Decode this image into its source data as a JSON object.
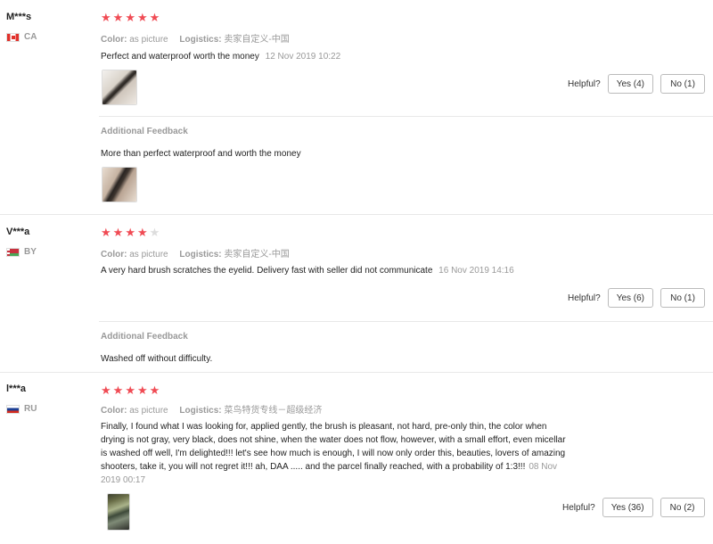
{
  "labels": {
    "color": "Color:",
    "logistics": "Logistics:",
    "helpful": "Helpful?",
    "additional_feedback": "Additional Feedback"
  },
  "colors": {
    "star": "#f04b54",
    "star_off": "#dddddd",
    "meta_text": "#999999"
  },
  "reviews": [
    {
      "user": "M***s",
      "country": "CA",
      "flag": "flag-canada-icon",
      "rating": 5,
      "color_value": "as picture",
      "logistics_value": "卖家自定义-中国",
      "text": "Perfect and waterproof worth the money",
      "date": "12 Nov 2019 10:22",
      "yes": "Yes (4)",
      "no": "No (1)",
      "additional_text": "More than perfect waterproof and worth the money"
    },
    {
      "user": "V***a",
      "country": "BY",
      "flag": "flag-belarus-icon",
      "rating": 4,
      "color_value": "as picture",
      "logistics_value": "卖家自定义-中国",
      "text": "A very hard brush scratches the eyelid. Delivery fast with seller did not communicate",
      "date": "16 Nov 2019 14:16",
      "yes": "Yes (6)",
      "no": "No (1)",
      "additional_text": "Washed off without difficulty."
    },
    {
      "user": "l***a",
      "country": "RU",
      "flag": "flag-russia-icon",
      "rating": 5,
      "color_value": "as picture",
      "logistics_value": "菜鸟特货专线－超级经济",
      "text_lines": [
        "Finally, I found what I was looking for, applied gently, the brush is pleasant, not hard, pre-only thin, the color when",
        "drying is not gray, very black, does not shine, when the water does not flow, however, with a small effort, even micellar",
        "is washed off well, I'm delighted!!! let's see how much is enough, I will now only order this, beauties, lovers of amazing",
        "shooters, take it, you will not regret it!!! ah, DAA ..... and the parcel finally reached, with a probability of 1:3!!!"
      ],
      "date_a": "08 Nov",
      "date_b": "2019 00:17",
      "yes": "Yes (36)",
      "no": "No (2)"
    }
  ]
}
